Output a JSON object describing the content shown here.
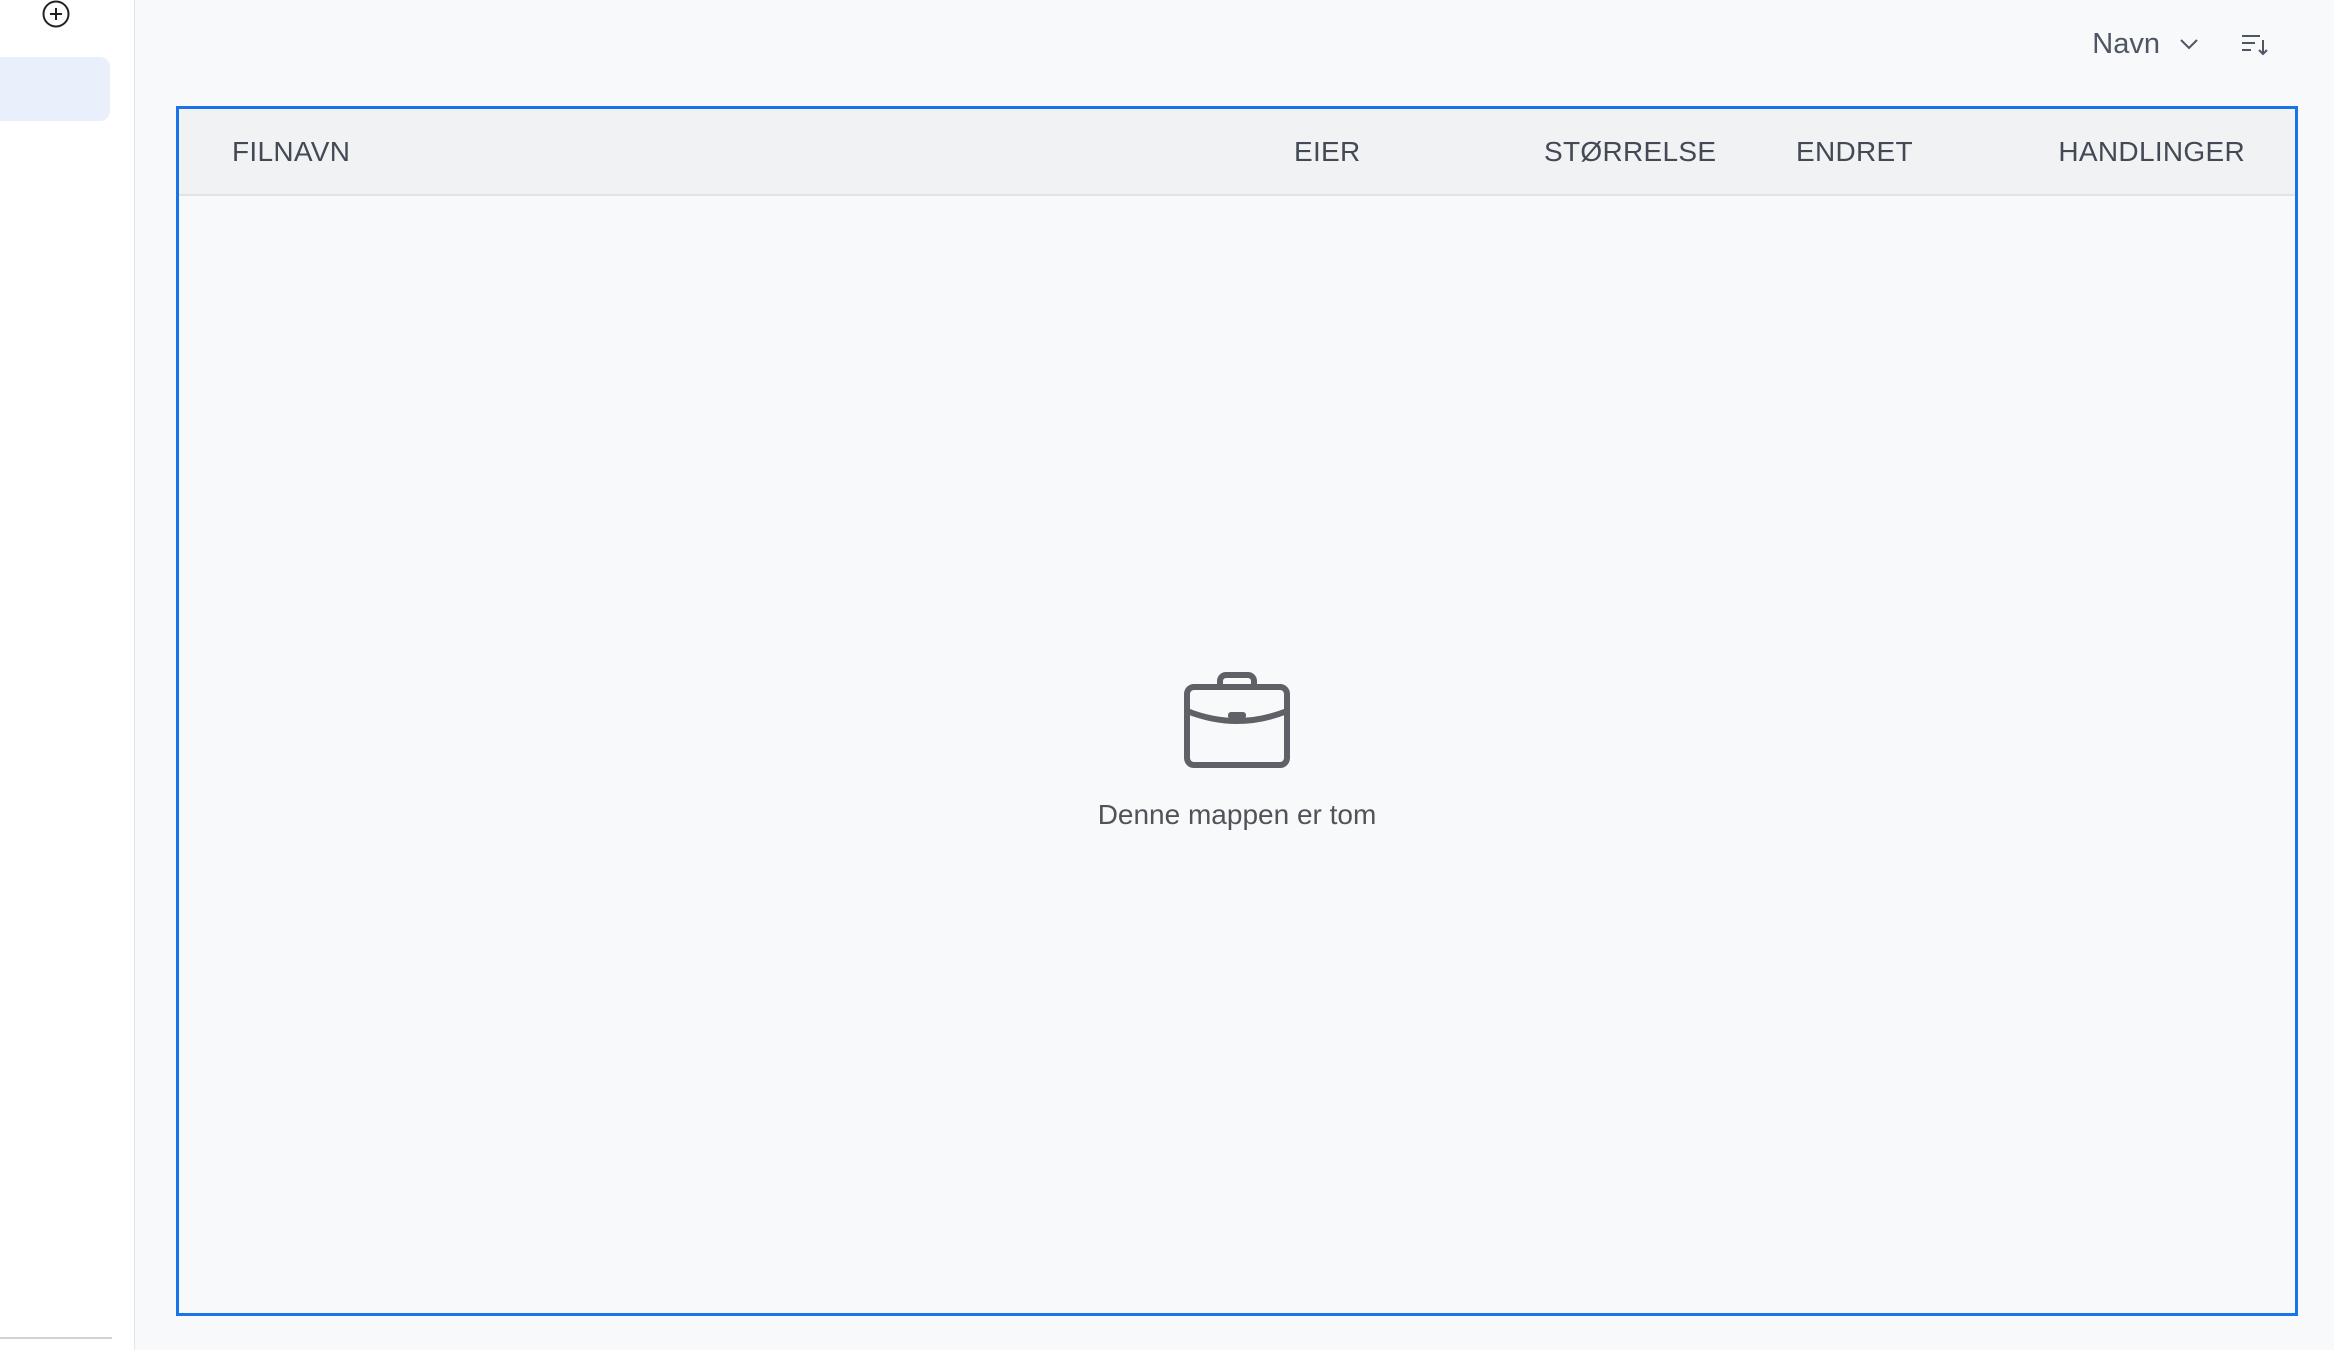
{
  "sort": {
    "selected": "Navn"
  },
  "table": {
    "columns": {
      "name": "FILNAVN",
      "owner": "EIER",
      "size": "STØRRELSE",
      "modified": "ENDRET",
      "actions": "HANDLINGER"
    }
  },
  "empty_state": {
    "message": "Denne mappen er tom",
    "icon": "briefcase-icon"
  },
  "colors": {
    "accent": "#1a73e8",
    "sidebar_active": "#e9f0fb",
    "header_bg": "#f1f2f4"
  }
}
